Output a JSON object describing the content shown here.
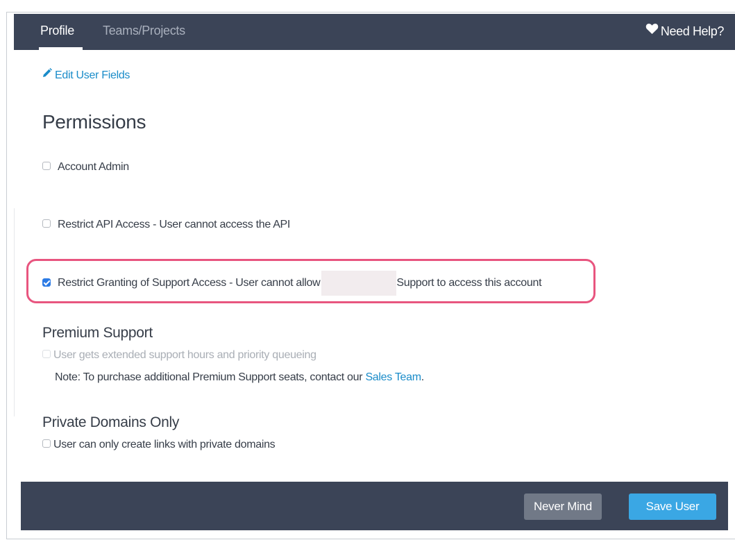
{
  "tabs": {
    "profile": "Profile",
    "teams": "Teams/Projects"
  },
  "help": {
    "label": "Need Help?"
  },
  "edit_link": "Edit User Fields",
  "permissions": {
    "title": "Permissions",
    "account_admin": "Account Admin",
    "restrict_api": "Restrict API Access - User cannot access the API",
    "restrict_support_pre": "Restrict Granting of Support Access - User cannot allow",
    "restrict_support_post": "Support to access this account"
  },
  "premium": {
    "title": "Premium Support",
    "option": "User gets extended support hours and priority queueing",
    "note_pre": "Note: To purchase additional Premium Support seats, contact our",
    "note_link": "Sales Team",
    "note_post": "."
  },
  "private_domains": {
    "title": "Private Domains Only",
    "option": "User can only create links with private domains"
  },
  "footer": {
    "never_mind": "Never Mind",
    "save": "Save User"
  },
  "checkboxes": {
    "account_admin": false,
    "restrict_api": false,
    "restrict_support": true,
    "premium": false,
    "private_domains": false
  },
  "colors": {
    "header_bg": "#3b4457",
    "link": "#1a8cc9",
    "highlight": "#e8557f",
    "save_button": "#3aa7e4",
    "never_button": "#717987"
  },
  "icons": {
    "help": "heart-icon",
    "edit": "pencil-icon"
  }
}
